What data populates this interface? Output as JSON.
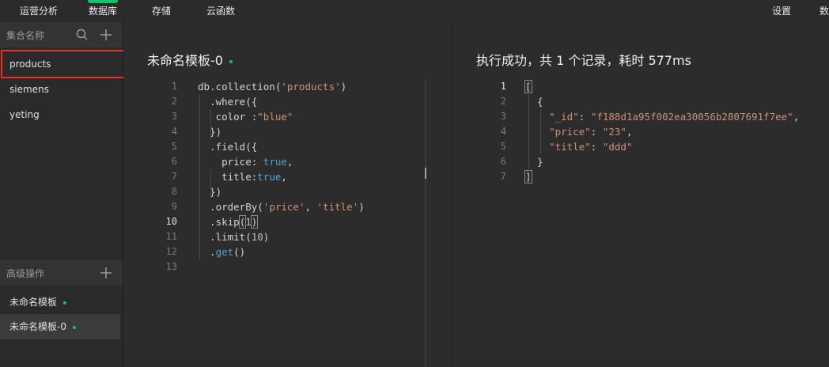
{
  "nav": {
    "items": [
      {
        "label": "运营分析"
      },
      {
        "label": "数据库"
      },
      {
        "label": "存储"
      },
      {
        "label": "云函数"
      },
      {
        "label": "设置"
      },
      {
        "label": "数"
      }
    ]
  },
  "sidebar": {
    "collections_header": "集合名称",
    "collections": [
      "products",
      "siemens",
      "yeting"
    ],
    "advanced_header": "高级操作",
    "templates": [
      "未命名模板",
      "未命名模板-0"
    ]
  },
  "editor": {
    "title": "未命名模板-0",
    "line_numbers": [
      "1",
      "2",
      "3",
      "4",
      "5",
      "6",
      "7",
      "8",
      "9",
      "10",
      "11",
      "12",
      "13"
    ],
    "lines": [
      [
        {
          "t": "db.collection(",
          "c": "plain"
        },
        {
          "t": "'products'",
          "c": "str"
        },
        {
          "t": ")",
          "c": "plain"
        }
      ],
      [
        {
          "t": "  .where({",
          "c": "plain"
        }
      ],
      [
        {
          "t": "   color :",
          "c": "plain"
        },
        {
          "t": "\"blue\"",
          "c": "str"
        }
      ],
      [
        {
          "t": "  })",
          "c": "plain"
        }
      ],
      [
        {
          "t": "  .field({",
          "c": "plain"
        }
      ],
      [
        {
          "t": "    price: ",
          "c": "plain"
        },
        {
          "t": "true",
          "c": "kw"
        },
        {
          "t": ",",
          "c": "plain"
        }
      ],
      [
        {
          "t": "    title:",
          "c": "plain"
        },
        {
          "t": "true",
          "c": "kw"
        },
        {
          "t": ",",
          "c": "plain"
        }
      ],
      [
        {
          "t": "  })",
          "c": "plain"
        }
      ],
      [
        {
          "t": "  .orderBy(",
          "c": "plain"
        },
        {
          "t": "'price'",
          "c": "str"
        },
        {
          "t": ", ",
          "c": "plain"
        },
        {
          "t": "'title'",
          "c": "str"
        },
        {
          "t": ")",
          "c": "plain"
        }
      ],
      [
        {
          "t": "  .skip",
          "c": "plain"
        },
        {
          "t": "(",
          "c": "plain",
          "box": true
        },
        {
          "t": "1",
          "c": "num"
        },
        {
          "t": ")",
          "c": "plain",
          "box": true
        }
      ],
      [
        {
          "t": "  .limit(",
          "c": "plain"
        },
        {
          "t": "10",
          "c": "num"
        },
        {
          "t": ")",
          "c": "plain"
        }
      ],
      [
        {
          "t": "  .",
          "c": "plain"
        },
        {
          "t": "get",
          "c": "kw"
        },
        {
          "t": "()",
          "c": "plain"
        }
      ],
      []
    ]
  },
  "result": {
    "title": "执行成功，共 1 个记录，耗时 577ms",
    "line_numbers": [
      "1",
      "2",
      "3",
      "4",
      "5",
      "6",
      "7"
    ],
    "lines": [
      [
        {
          "t": "[",
          "c": "plain",
          "box": true
        }
      ],
      [
        {
          "t": "  {",
          "c": "plain"
        }
      ],
      [
        {
          "t": "    ",
          "c": "plain"
        },
        {
          "t": "\"_id\"",
          "c": "key"
        },
        {
          "t": ": ",
          "c": "plain"
        },
        {
          "t": "\"f188d1a95f002ea30056b2807691f7ee\"",
          "c": "str"
        },
        {
          "t": ",",
          "c": "plain"
        }
      ],
      [
        {
          "t": "    ",
          "c": "plain"
        },
        {
          "t": "\"price\"",
          "c": "key"
        },
        {
          "t": ": ",
          "c": "plain"
        },
        {
          "t": "\"23\"",
          "c": "str"
        },
        {
          "t": ",",
          "c": "plain"
        }
      ],
      [
        {
          "t": "    ",
          "c": "plain"
        },
        {
          "t": "\"title\"",
          "c": "key"
        },
        {
          "t": ": ",
          "c": "plain"
        },
        {
          "t": "\"ddd\"",
          "c": "str"
        }
      ],
      [
        {
          "t": "  }",
          "c": "plain"
        }
      ],
      [
        {
          "t": "]",
          "c": "plain",
          "box": true
        }
      ]
    ]
  },
  "colors": {
    "accent_green": "#13c26b",
    "highlight_red": "#e8322c"
  },
  "icons": [
    "search-icon",
    "plus-icon"
  ]
}
